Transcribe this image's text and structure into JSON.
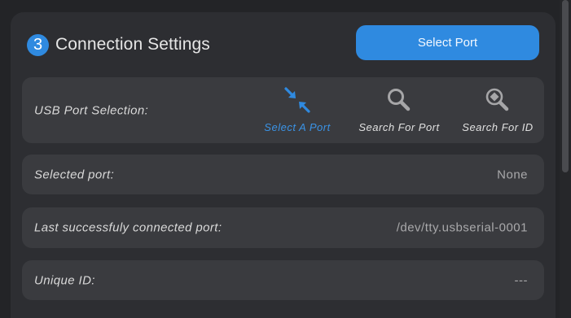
{
  "header": {
    "step_number": "3",
    "title": "Connection Settings",
    "select_port_button": "Select Port"
  },
  "usb": {
    "label": "USB Port Selection:",
    "options": [
      {
        "label": "Select A Port",
        "icon": "select-port-icon",
        "active": true
      },
      {
        "label": "Search For Port",
        "icon": "search-icon",
        "active": false
      },
      {
        "label": "Search For ID",
        "icon": "search-id-icon",
        "active": false
      }
    ]
  },
  "rows": {
    "selected_port": {
      "label": "Selected port:",
      "value": "None"
    },
    "last_connected": {
      "label": "Last successfuly connected port:",
      "value": "/dev/tty.usbserial-0001"
    },
    "unique_id": {
      "label": "Unique ID:",
      "value": "---"
    }
  },
  "colors": {
    "accent": "#2f8ae0",
    "panel": "#2d2e32",
    "row": "#3a3b3f",
    "active_option": "#3a93e6"
  }
}
